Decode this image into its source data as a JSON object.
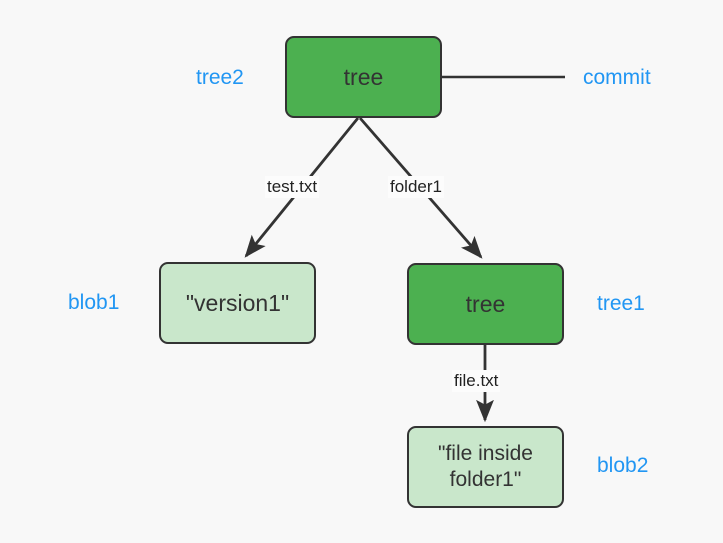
{
  "diagram": {
    "type": "git-object-graph",
    "background_color": "#f8f8f8",
    "colors": {
      "tree_fill": "#4cb050",
      "blob_fill": "#c9e7cb",
      "node_stroke": "#333333",
      "edge_stroke": "#333333",
      "side_label": "#2196f3",
      "edge_label_text": "#222222"
    },
    "nodes": [
      {
        "id": "tree2",
        "kind": "tree",
        "text": "tree",
        "side_label": "tree2",
        "side_label_position": "left"
      },
      {
        "id": "blob1",
        "kind": "blob",
        "text": "\"version1\"",
        "side_label": "blob1",
        "side_label_position": "left"
      },
      {
        "id": "tree1",
        "kind": "tree",
        "text": "tree",
        "side_label": "tree1",
        "side_label_position": "right"
      },
      {
        "id": "blob2",
        "kind": "blob",
        "text": "\"file inside\nfolder1\"",
        "side_label": "blob2",
        "side_label_position": "right"
      }
    ],
    "external_labels": [
      {
        "id": "commit",
        "text": "commit",
        "connects_to": "tree2"
      }
    ],
    "edges": [
      {
        "from": "tree2",
        "to": "blob1",
        "label": "test.txt",
        "arrow": true
      },
      {
        "from": "tree2",
        "to": "tree1",
        "label": "folder1",
        "arrow": true
      },
      {
        "from": "tree1",
        "to": "blob2",
        "label": "file.txt",
        "arrow": true
      },
      {
        "from": "tree2",
        "to": "commit",
        "label": "",
        "arrow": false
      }
    ]
  }
}
